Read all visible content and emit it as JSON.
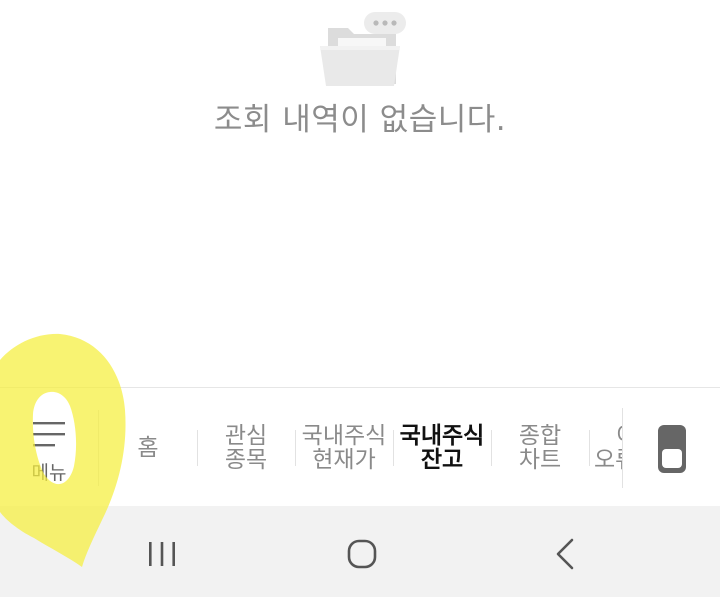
{
  "empty_state": {
    "icon": "empty-folder-icon",
    "message": "조회 내역이 없습니다."
  },
  "tabbar": {
    "menu": {
      "icon": "hamburger-icon",
      "label": "메뉴"
    },
    "tabs": [
      {
        "id": "home",
        "line1": "홈",
        "line2": "",
        "active": false
      },
      {
        "id": "watchlist",
        "line1": "관심",
        "line2": "종목",
        "active": false
      },
      {
        "id": "domestic-price",
        "line1": "국내주식",
        "line2": "현재가",
        "active": false
      },
      {
        "id": "domestic-balance",
        "line1": "국내주식",
        "line2": "잔고",
        "active": true
      },
      {
        "id": "chart",
        "line1": "종합",
        "line2": "차트",
        "active": false
      },
      {
        "id": "partial",
        "line1": "이",
        "line2": "오류",
        "active": false
      }
    ],
    "toggle_icon": "toggle-switch-icon",
    "colors": {
      "inactive_text": "#8a8a8a",
      "active_text": "#111111",
      "divider": "#e2e2e2"
    }
  },
  "navbar": {
    "buttons": [
      {
        "id": "recent-apps",
        "icon": "recent-apps-icon"
      },
      {
        "id": "home",
        "icon": "home-circle-icon"
      },
      {
        "id": "back",
        "icon": "back-chevron-icon"
      }
    ],
    "background": "#f2f2f2"
  },
  "overlay": {
    "color": "#f5ee3c",
    "description_shape": "freehand-circle-marker"
  }
}
